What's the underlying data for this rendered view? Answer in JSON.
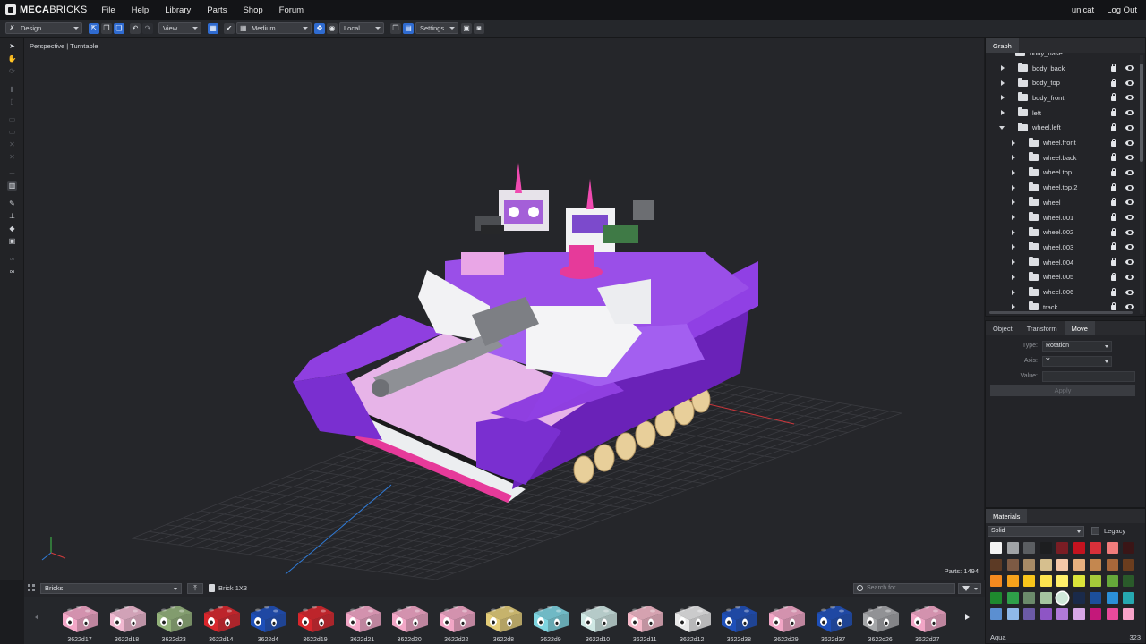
{
  "app": {
    "brand_bold": "MECA",
    "brand_rest": "BRICKS",
    "menu": [
      "File",
      "Help",
      "Library",
      "Parts",
      "Shop",
      "Forum"
    ],
    "user": "unicat",
    "logout": "Log Out"
  },
  "toolbar": {
    "mode": "Design",
    "view": "View",
    "quality": "Medium",
    "space": "Local",
    "settings": "Settings"
  },
  "viewport": {
    "title": "Perspective | Turntable",
    "parts_count": "Parts: 1494"
  },
  "graph": {
    "tab": "Graph",
    "partial_top": "body_base",
    "items": [
      {
        "label": "body_back",
        "depth": 0,
        "open": false
      },
      {
        "label": "body_top",
        "depth": 0,
        "open": false
      },
      {
        "label": "body_front",
        "depth": 0,
        "open": false
      },
      {
        "label": "left",
        "depth": 0,
        "open": false
      },
      {
        "label": "wheel.left",
        "depth": 0,
        "open": true
      },
      {
        "label": "wheel.front",
        "depth": 1,
        "open": false
      },
      {
        "label": "wheel.back",
        "depth": 1,
        "open": false
      },
      {
        "label": "wheel.top",
        "depth": 1,
        "open": false
      },
      {
        "label": "wheel.top.2",
        "depth": 1,
        "open": false
      },
      {
        "label": "wheel",
        "depth": 1,
        "open": false
      },
      {
        "label": "wheel.001",
        "depth": 1,
        "open": false
      },
      {
        "label": "wheel.002",
        "depth": 1,
        "open": false
      },
      {
        "label": "wheel.003",
        "depth": 1,
        "open": false
      },
      {
        "label": "wheel.004",
        "depth": 1,
        "open": false
      },
      {
        "label": "wheel.005",
        "depth": 1,
        "open": false
      },
      {
        "label": "wheel.006",
        "depth": 1,
        "open": false
      },
      {
        "label": "track",
        "depth": 1,
        "open": false
      }
    ]
  },
  "properties": {
    "tabs": [
      "Object",
      "Transform",
      "Move"
    ],
    "active_tab": "Move",
    "type_label": "Type:",
    "type_value": "Rotation",
    "axis_label": "Axis:",
    "axis_value": "Y",
    "value_label": "Value:",
    "value_value": "",
    "apply": "Apply"
  },
  "materials": {
    "tab": "Materials",
    "type": "Solid",
    "legacy": "Legacy",
    "selected_name": "Aqua",
    "selected_id": "323",
    "colors": [
      [
        "#f4f4f4",
        "#a0a3a6",
        "#5b5e62",
        "#1d1e20",
        "#7a1d24",
        "#c4131f",
        "#d9303a",
        "#f07c7c",
        "#3a1516"
      ],
      [
        "#5c3a25",
        "#7d5a44",
        "#a68a66",
        "#d6bf8e",
        "#f5c8a8",
        "#e7b07e",
        "#c4874f",
        "#a8673a",
        "#6b3d1e"
      ],
      [
        "#f58a1f",
        "#f6a21b",
        "#f8c51b",
        "#fbe34f",
        "#fff06a",
        "#dbe43a",
        "#a5c93a",
        "#66a83a",
        "#2a5a2a"
      ],
      [
        "#1e8a2e",
        "#2e9f49",
        "#6b8a6b",
        "#a5c5a0",
        "#cfe8d9",
        "#1a2a4a",
        "#1c4f9c",
        "#2b8fd8",
        "#26a8b0"
      ],
      [
        "#5b8fd1",
        "#8fb8e8",
        "#6b5aa5",
        "#8e55c5",
        "#b07ad8",
        "#d7a8e6",
        "#c4187a",
        "#e84a9c",
        "#f7a3c8"
      ]
    ]
  },
  "parts": {
    "category": "Bricks",
    "breadcrumb": "Brick 1X3",
    "search_placeholder": "Search for...",
    "items": [
      {
        "id": "3622d17",
        "color": "#f2a6c6"
      },
      {
        "id": "3622d18",
        "color": "#f0b8d0"
      },
      {
        "id": "3622d23",
        "color": "#93b27a"
      },
      {
        "id": "3622d14",
        "color": "#d8262c"
      },
      {
        "id": "3622d4",
        "color": "#1e4fb8"
      },
      {
        "id": "3622d19",
        "color": "#d8262c"
      },
      {
        "id": "3622d21",
        "color": "#f2a6c6"
      },
      {
        "id": "3622d20",
        "color": "#f2a6c6"
      },
      {
        "id": "3622d22",
        "color": "#f2a6c6"
      },
      {
        "id": "3622d8",
        "color": "#e3cc78"
      },
      {
        "id": "3622d9",
        "color": "#7ed4e0"
      },
      {
        "id": "3622d10",
        "color": "#cfe8e4"
      },
      {
        "id": "3622d11",
        "color": "#f5b8c8"
      },
      {
        "id": "3622d12",
        "color": "#e9e9e9"
      },
      {
        "id": "3622d38",
        "color": "#1e4fb8"
      },
      {
        "id": "3622d29",
        "color": "#f2a6c6"
      },
      {
        "id": "3622d37",
        "color": "#1e4fb8"
      },
      {
        "id": "3622d26",
        "color": "#a4a6a8"
      },
      {
        "id": "3622d27",
        "color": "#f2a6c6"
      }
    ]
  }
}
